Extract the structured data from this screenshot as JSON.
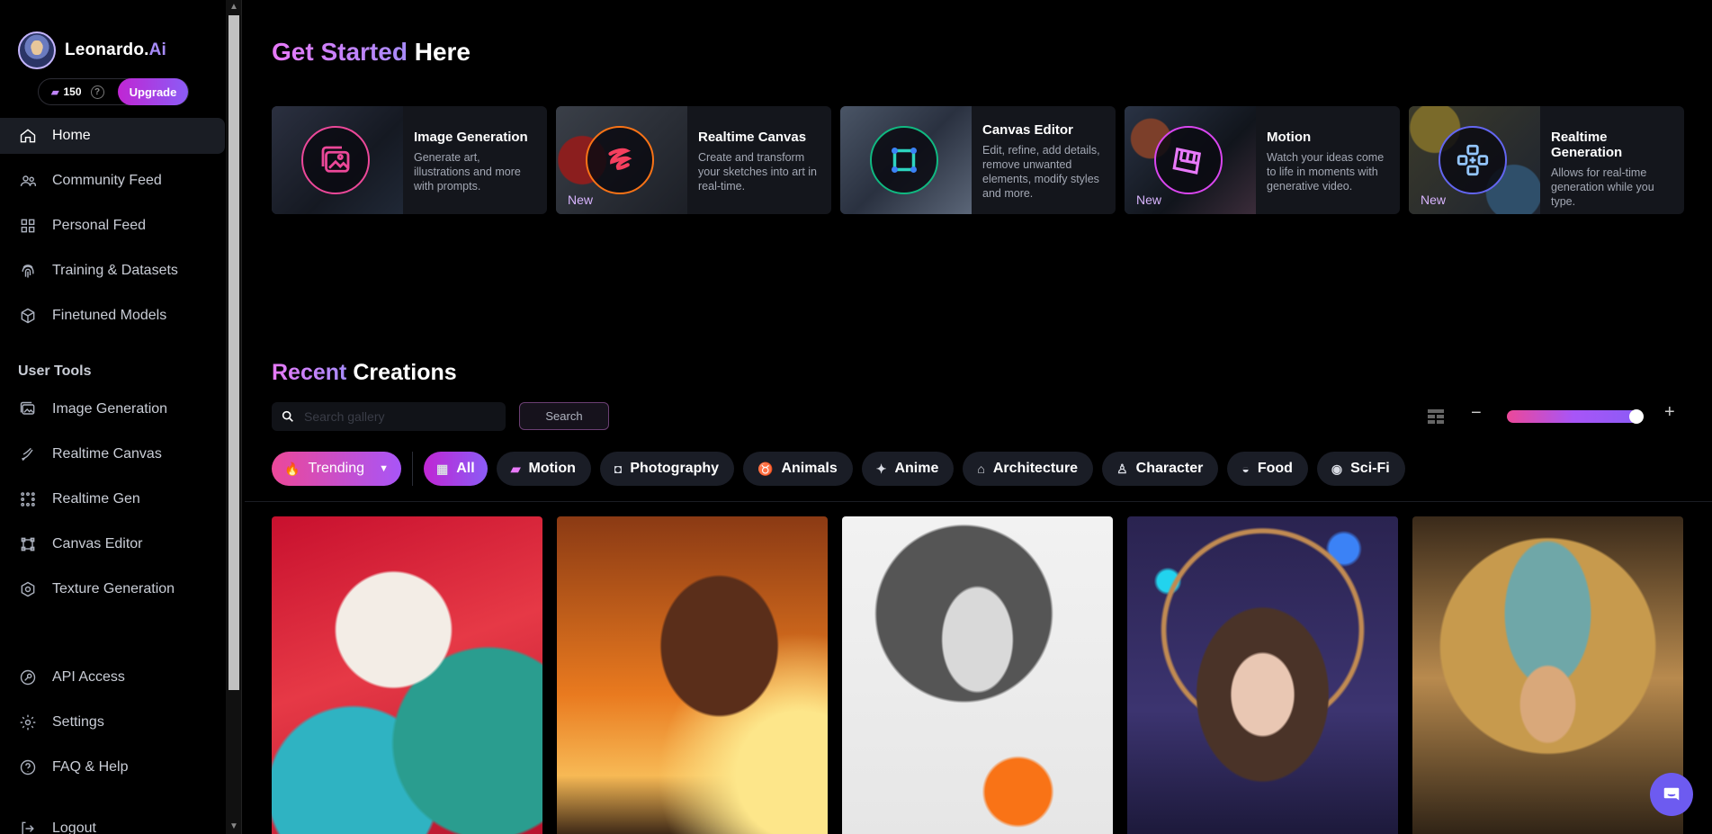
{
  "brand": {
    "name": "Leonardo.",
    "suffix": "Ai"
  },
  "credits": {
    "count": "150",
    "help": "?",
    "upgrade_label": "Upgrade"
  },
  "nav_main": [
    {
      "label": "Home",
      "icon": "home-icon",
      "active": true
    },
    {
      "label": "Community Feed",
      "icon": "users-icon"
    },
    {
      "label": "Personal Feed",
      "icon": "grid-icon"
    },
    {
      "label": "Training & Datasets",
      "icon": "fingerprint-icon"
    },
    {
      "label": "Finetuned Models",
      "icon": "cube-icon"
    }
  ],
  "user_tools_title": "User Tools",
  "nav_tools": [
    {
      "label": "Image Generation",
      "icon": "image-icon"
    },
    {
      "label": "Realtime Canvas",
      "icon": "brush-icon"
    },
    {
      "label": "Realtime Gen",
      "icon": "dots-grid-icon"
    },
    {
      "label": "Canvas Editor",
      "icon": "square-nodes-icon"
    },
    {
      "label": "Texture Generation",
      "icon": "texture-cube-icon"
    }
  ],
  "nav_bottom": [
    {
      "label": "API Access",
      "icon": "key-icon"
    },
    {
      "label": "Settings",
      "icon": "gear-icon"
    },
    {
      "label": "FAQ & Help",
      "icon": "question-icon"
    },
    {
      "label": "Logout",
      "icon": "logout-icon"
    }
  ],
  "get_started": {
    "accent": "Get Started",
    "rest": "Here"
  },
  "feature_cards": [
    {
      "title": "Image Generation",
      "desc": "Generate art, illustrations and more with prompts.",
      "badge": "",
      "icon": "image-stack-icon",
      "ring": "#ec4899"
    },
    {
      "title": "Realtime Canvas",
      "desc": "Create and transform your sketches into art in real-time.",
      "badge": "New",
      "icon": "squiggle-icon",
      "ring": "#f97316"
    },
    {
      "title": "Canvas Editor",
      "desc": "Edit, refine, add details, remove unwanted elements, modify styles and more.",
      "badge": "",
      "icon": "square-nodes-icon",
      "ring": "#10b981"
    },
    {
      "title": "Motion",
      "desc": "Watch your ideas come to life in moments with generative video.",
      "badge": "New",
      "icon": "film-icon",
      "ring": "#d946ef"
    },
    {
      "title": "Realtime Generation",
      "desc": "Allows for real-time generation while you type.",
      "badge": "New",
      "icon": "dots-grid-icon",
      "ring": "#6366f1"
    }
  ],
  "recent": {
    "accent": "Recent",
    "rest": "Creations"
  },
  "search": {
    "placeholder": "Search gallery",
    "button": "Search"
  },
  "zoom": {
    "minus": "−",
    "plus": "+",
    "level": 0.95
  },
  "filters": {
    "trending": "Trending",
    "chips": [
      {
        "label": "All",
        "icon": "grid-icon",
        "active": true
      },
      {
        "label": "Motion",
        "icon": "film-icon"
      },
      {
        "label": "Photography",
        "icon": "camera-icon"
      },
      {
        "label": "Animals",
        "icon": "cat-icon"
      },
      {
        "label": "Anime",
        "icon": "sparkle-icon"
      },
      {
        "label": "Architecture",
        "icon": "building-icon"
      },
      {
        "label": "Character",
        "icon": "person-icon"
      },
      {
        "label": "Food",
        "icon": "bowl-icon"
      },
      {
        "label": "Sci-Fi",
        "icon": "alien-icon"
      }
    ]
  },
  "gallery": [
    {
      "name": "paper-art-warrior-image"
    },
    {
      "name": "sunset-silhouette-woman-image"
    },
    {
      "name": "ink-portrait-woman-image"
    },
    {
      "name": "dreamcatcher-girl-image"
    },
    {
      "name": "egyptian-queen-image"
    }
  ]
}
